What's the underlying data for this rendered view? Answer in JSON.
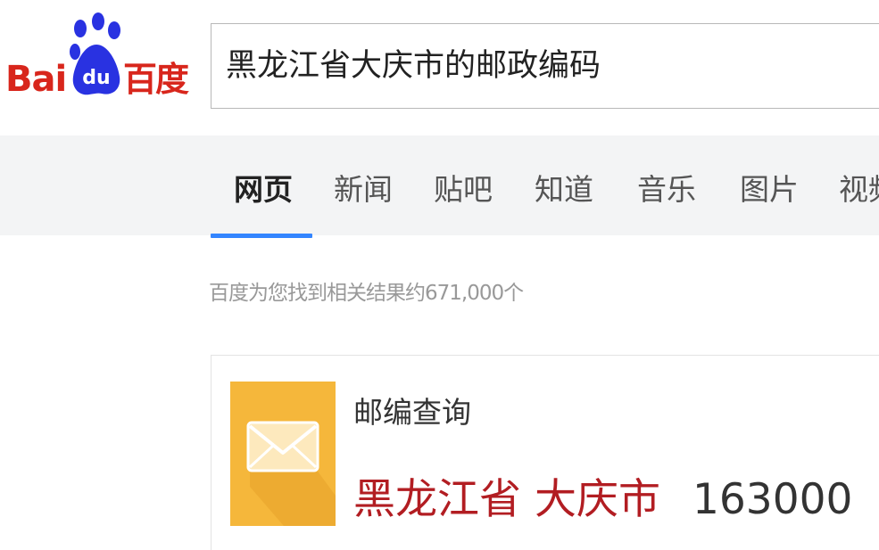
{
  "logo": {
    "latin": "Bai",
    "paw_text": "du",
    "chinese": "百度",
    "brand_color": "#d8261c",
    "paw_color": "#2932e1"
  },
  "search": {
    "query": "黑龙江省大庆市的邮政编码"
  },
  "tabs": [
    {
      "label": "网页",
      "active": true
    },
    {
      "label": "新闻",
      "active": false
    },
    {
      "label": "贴吧",
      "active": false
    },
    {
      "label": "知道",
      "active": false
    },
    {
      "label": "音乐",
      "active": false
    },
    {
      "label": "图片",
      "active": false
    },
    {
      "label": "视频",
      "active": false
    }
  ],
  "results": {
    "stats": "百度为您找到相关结果约671,000个"
  },
  "postcode_card": {
    "title": "邮编查询",
    "region": "黑龙江省 大庆市",
    "code": "163000",
    "icon": "mail-envelope-icon",
    "icon_color": "#f5b73b"
  },
  "colors": {
    "accent_underline": "#3385ff",
    "nav_background": "#f3f4f5",
    "region_text": "#b21d22"
  }
}
